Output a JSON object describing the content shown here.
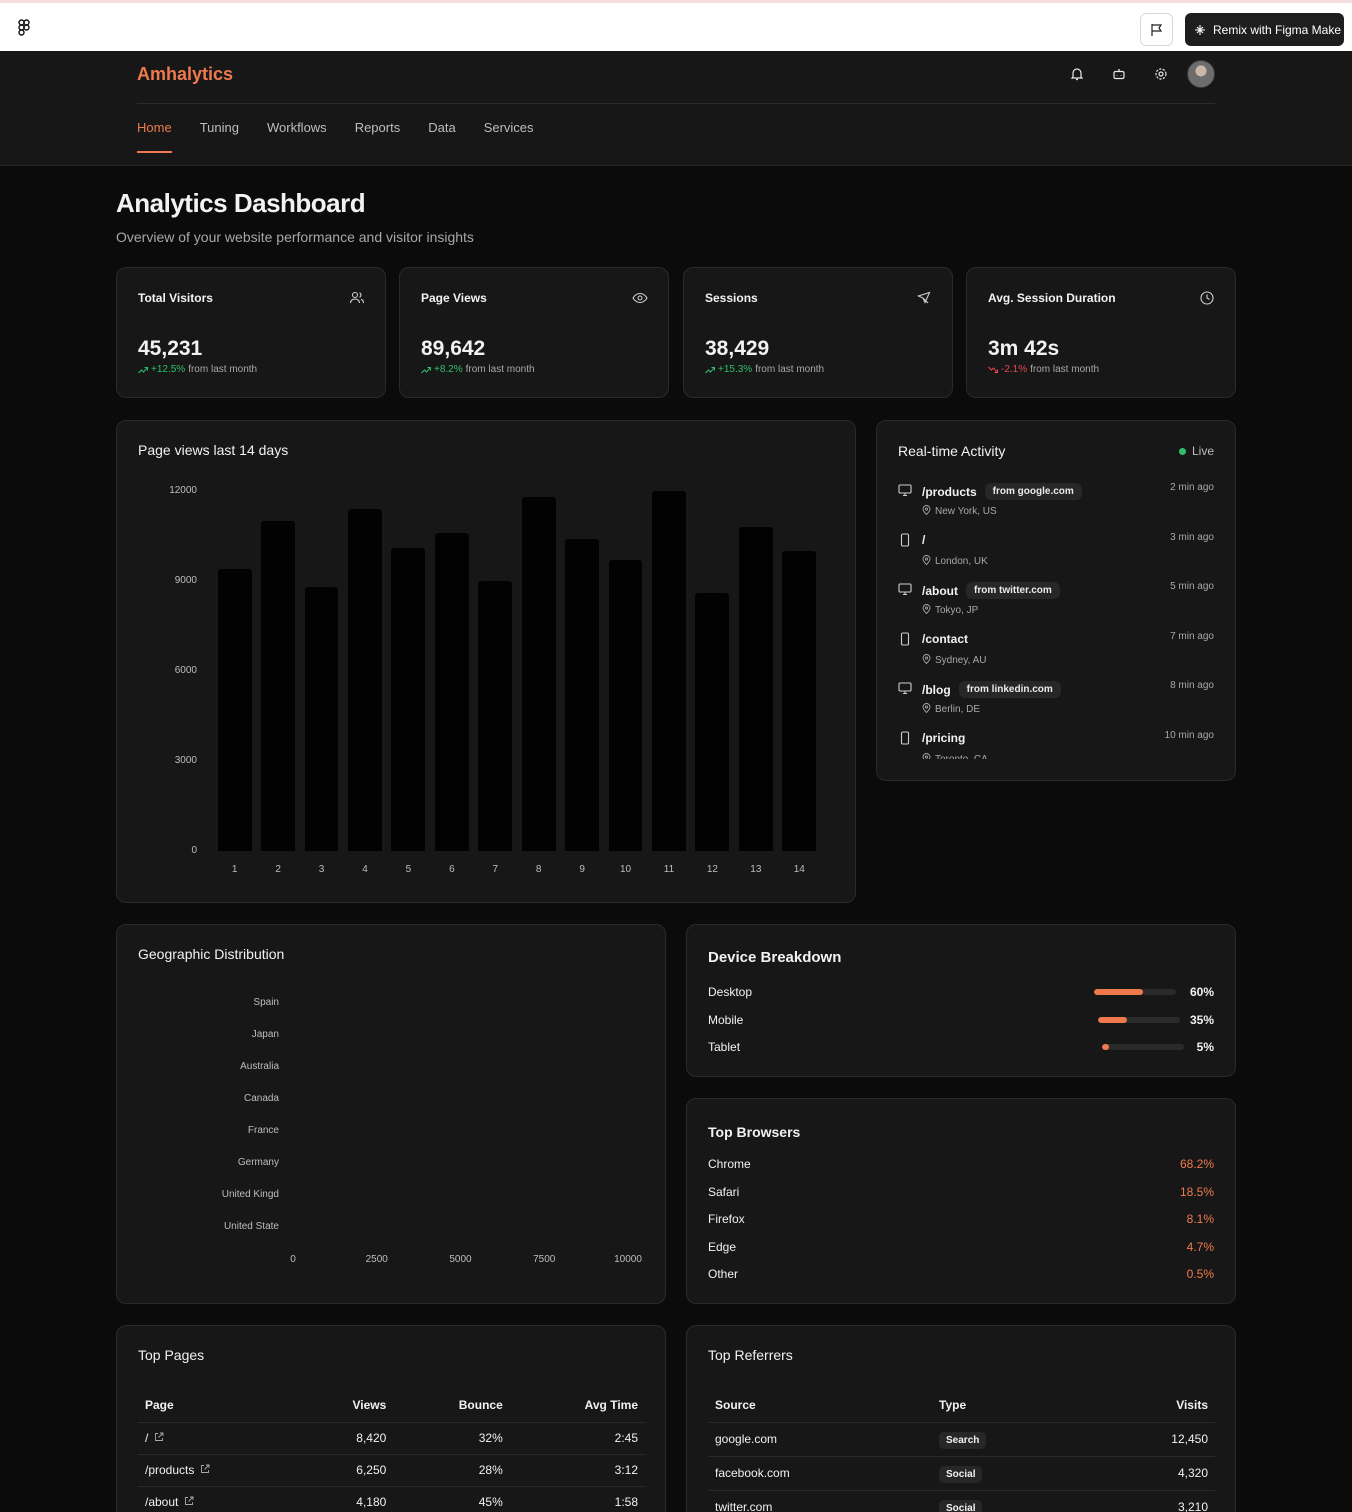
{
  "figma_bar": {
    "remix_label": "Remix with Figma Make"
  },
  "app": {
    "brand": "Amhalytics"
  },
  "nav": [
    "Home",
    "Tuning",
    "Workflows",
    "Reports",
    "Data",
    "Services"
  ],
  "page": {
    "title": "Analytics Dashboard",
    "subtitle": "Overview of your website performance and visitor insights"
  },
  "stats": [
    {
      "label": "Total Visitors",
      "value": "45,231",
      "change": "+12.5%",
      "suffix": "from last month",
      "trend": "up",
      "icon": "users-icon"
    },
    {
      "label": "Page Views",
      "value": "89,642",
      "change": "+8.2%",
      "suffix": "from last month",
      "trend": "up",
      "icon": "eye-icon"
    },
    {
      "label": "Sessions",
      "value": "38,429",
      "change": "+15.3%",
      "suffix": "from last month",
      "trend": "up",
      "icon": "cursor-icon"
    },
    {
      "label": "Avg. Session Duration",
      "value": "3m 42s",
      "change": "-2.1%",
      "suffix": "from last month",
      "trend": "down",
      "icon": "clock-icon"
    }
  ],
  "chart_data": [
    {
      "type": "bar",
      "title": "Page views last 14 days",
      "categories": [
        "1",
        "2",
        "3",
        "4",
        "5",
        "6",
        "7",
        "8",
        "9",
        "10",
        "11",
        "12",
        "13",
        "14"
      ],
      "values": [
        9400,
        11000,
        8800,
        11400,
        10100,
        10600,
        9000,
        11800,
        10400,
        9700,
        12000,
        8600,
        10800,
        10000
      ],
      "yticks": [
        "0",
        "3000",
        "6000",
        "9000",
        "12000"
      ],
      "ylim": [
        0,
        12000
      ],
      "color": "#020202"
    },
    {
      "type": "bar",
      "orientation": "horizontal",
      "title": "Geographic Distribution",
      "categories": [
        "Spain",
        "Japan",
        "Australia",
        "Canada",
        "France",
        "Germany",
        "United Kingd",
        "United State"
      ],
      "values": [],
      "xticks": [
        "0",
        "2500",
        "5000",
        "7500",
        "10000"
      ],
      "xlim": [
        0,
        10000
      ]
    }
  ],
  "activity": {
    "title": "Real-time Activity",
    "live_label": "Live",
    "items": [
      {
        "page": "/products",
        "ref": "from google.com",
        "loc": "New York, US",
        "time": "2 min ago",
        "device": "desktop-icon"
      },
      {
        "page": "/",
        "ref": "",
        "loc": "London, UK",
        "time": "3 min ago",
        "device": "mobile-icon"
      },
      {
        "page": "/about",
        "ref": "from twitter.com",
        "loc": "Tokyo, JP",
        "time": "5 min ago",
        "device": "desktop-icon"
      },
      {
        "page": "/contact",
        "ref": "",
        "loc": "Sydney, AU",
        "time": "7 min ago",
        "device": "mobile-icon"
      },
      {
        "page": "/blog",
        "ref": "from linkedin.com",
        "loc": "Berlin, DE",
        "time": "8 min ago",
        "device": "desktop-icon"
      },
      {
        "page": "/pricing",
        "ref": "",
        "loc": "Toronto, CA",
        "time": "10 min ago",
        "device": "mobile-icon"
      }
    ]
  },
  "devices": {
    "title": "Device Breakdown",
    "items": [
      {
        "name": "Desktop",
        "value": "60%",
        "fraction": 0.6
      },
      {
        "name": "Mobile",
        "value": "35%",
        "fraction": 0.35
      },
      {
        "name": "Tablet",
        "value": "5%",
        "fraction": 0.05
      }
    ]
  },
  "browsers": {
    "title": "Top Browsers",
    "items": [
      {
        "name": "Chrome",
        "value": "68.2%"
      },
      {
        "name": "Safari",
        "value": "18.5%"
      },
      {
        "name": "Firefox",
        "value": "8.1%"
      },
      {
        "name": "Edge",
        "value": "4.7%"
      },
      {
        "name": "Other",
        "value": "0.5%"
      }
    ]
  },
  "top_pages": {
    "title": "Top Pages",
    "headers": [
      "Page",
      "Views",
      "Bounce",
      "Avg Time"
    ],
    "rows": [
      {
        "page": "/",
        "views": "8,420",
        "bounce": "32%",
        "time": "2:45"
      },
      {
        "page": "/products",
        "views": "6,250",
        "bounce": "28%",
        "time": "3:12"
      },
      {
        "page": "/about",
        "views": "4,180",
        "bounce": "45%",
        "time": "1:58"
      }
    ]
  },
  "top_referrers": {
    "title": "Top Referrers",
    "headers": [
      "Source",
      "Type",
      "Visits"
    ],
    "rows": [
      {
        "source": "google.com",
        "type": "Search",
        "visits": "12,450"
      },
      {
        "source": "facebook.com",
        "type": "Social",
        "visits": "4,320"
      },
      {
        "source": "twitter.com",
        "type": "Social",
        "visits": "3,210"
      }
    ]
  },
  "colors": {
    "accent": "#ef7a4e",
    "positive": "#2fbf6b",
    "negative": "#e5484d",
    "card": "#171717",
    "background": "#0b0b0b"
  }
}
